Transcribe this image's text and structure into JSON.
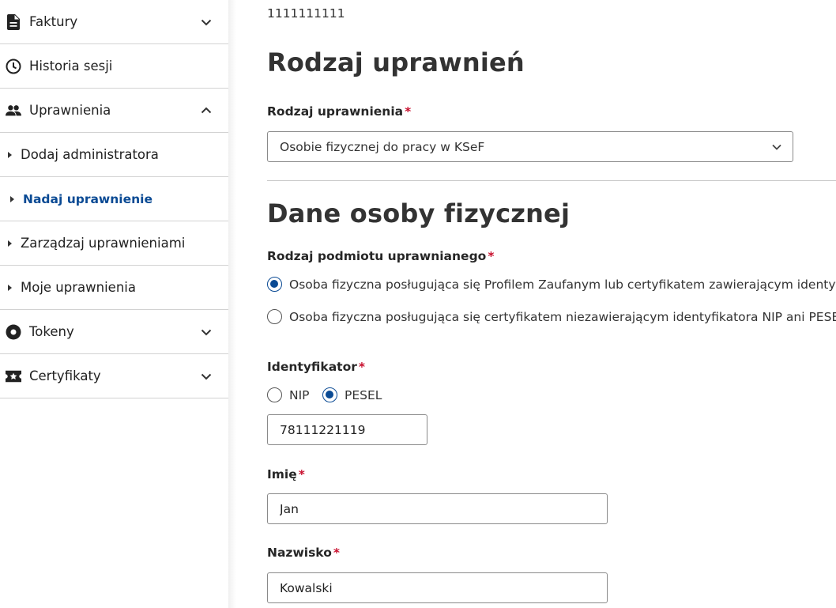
{
  "sidebar": {
    "items": [
      {
        "label": "Faktury",
        "icon": "document-icon",
        "expanded": false
      },
      {
        "label": "Historia sesji",
        "icon": "clock-icon"
      },
      {
        "label": "Uprawnienia",
        "icon": "people-icon",
        "expanded": true
      },
      {
        "label": "Dodaj administratora",
        "sub": true
      },
      {
        "label": "Nadaj uprawnienie",
        "sub": true,
        "active": true
      },
      {
        "label": "Zarządzaj uprawnieniami",
        "sub": true
      },
      {
        "label": "Moje uprawnienia",
        "sub": true
      },
      {
        "label": "Tokeny",
        "icon": "token-icon",
        "expanded": false
      },
      {
        "label": "Certyfikaty",
        "icon": "certificate-icon",
        "expanded": false
      }
    ]
  },
  "main": {
    "top_value": "1111111111",
    "section1_title": "Rodzaj uprawnień",
    "permission_type_label": "Rodzaj uprawnienia",
    "permission_type_value": "Osobie fizycznej do pracy w KSeF",
    "section2_title": "Dane osoby fizycznej",
    "subject_type_label": "Rodzaj podmiotu uprawnianego",
    "subject_options": [
      {
        "label": "Osoba fizyczna posługująca się Profilem Zaufanym lub certyfikatem zawierającym identyfikator",
        "checked": true
      },
      {
        "label": "Osoba fizyczna posługująca się certyfikatem niezawierającym identyfikatora NIP ani PESEL",
        "checked": false
      }
    ],
    "identifier_label": "Identyfikator",
    "identifier_options": [
      {
        "label": "NIP",
        "checked": false
      },
      {
        "label": "PESEL",
        "checked": true
      }
    ],
    "identifier_value": "78111221119",
    "first_name_label": "Imię",
    "first_name_value": "Jan",
    "last_name_label": "Nazwisko",
    "last_name_value": "Kowalski",
    "required_mark": "*"
  },
  "colors": {
    "accent": "#0a4a94",
    "required": "#c8102e",
    "text": "#212121",
    "border": "#d2d2d2"
  }
}
